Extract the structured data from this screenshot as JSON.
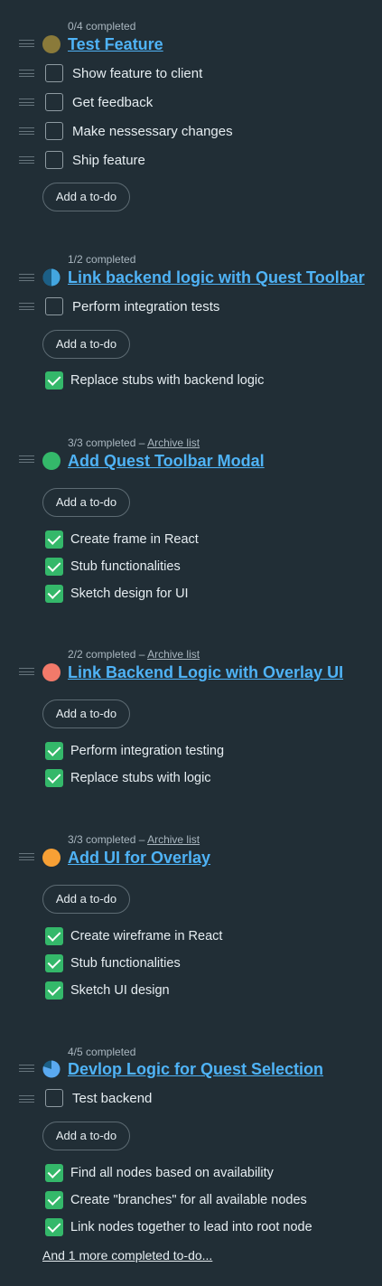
{
  "lists": [
    {
      "meta": "0/4 completed",
      "title": "Test Feature",
      "status_color": "#8a7a3a",
      "open_todos": [
        "Show feature to client",
        "Get feedback",
        "Make nessessary changes",
        "Ship feature"
      ],
      "add_label": "Add a to-do",
      "completed_todos": []
    },
    {
      "meta": "1/2 completed",
      "title": "Link backend logic with Quest Toolbar",
      "status_icon": "half-progress-icon",
      "open_todos": [
        "Perform integration tests"
      ],
      "add_label": "Add a to-do",
      "completed_todos": [
        "Replace stubs with backend logic"
      ]
    },
    {
      "meta": "3/3 completed – ",
      "archive_label": "Archive list",
      "title": "Add Quest Toolbar Modal",
      "status_color": "#34b86a",
      "add_label": "Add a to-do",
      "completed_todos": [
        "Create frame in React",
        "Stub functionalities",
        "Sketch design for UI"
      ]
    },
    {
      "meta": "2/2 completed – ",
      "archive_label": "Archive list",
      "title": "Link Backend Logic with Overlay UI",
      "status_color": "#f27a6a",
      "add_label": "Add a to-do",
      "completed_todos": [
        "Perform integration testing",
        "Replace stubs with logic"
      ]
    },
    {
      "meta": "3/3 completed – ",
      "archive_label": "Archive list",
      "title": "Add UI for Overlay",
      "status_color": "#f7a035",
      "add_label": "Add a to-do",
      "completed_todos": [
        "Create wireframe in React",
        "Stub functionalities",
        "Sketch UI design"
      ]
    },
    {
      "meta": "4/5 completed",
      "title": "Devlop Logic for Quest Selection",
      "status_icon": "mostly-complete-progress-icon",
      "open_todos": [
        "Test backend"
      ],
      "add_label": "Add a to-do",
      "completed_todos": [
        "Find all nodes based on availability",
        "Create \"branches\" for all available nodes",
        "Link nodes together to lead into root node"
      ],
      "more_label": "And 1 more completed to-do..."
    }
  ]
}
